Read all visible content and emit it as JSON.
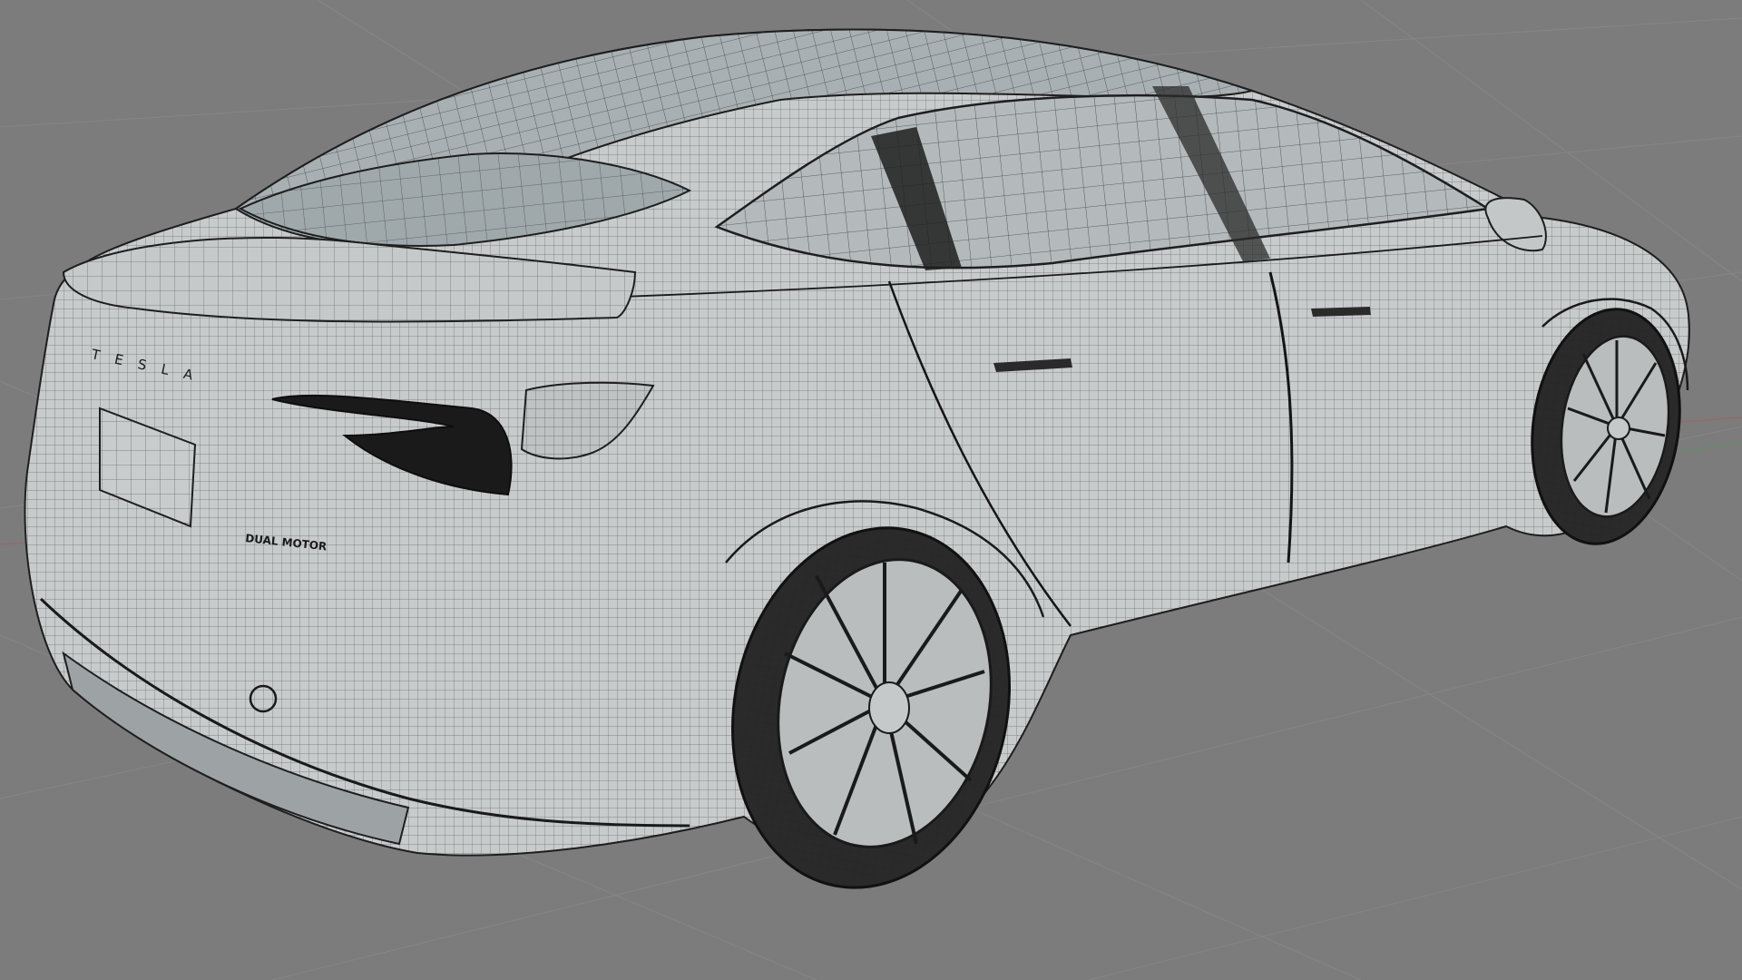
{
  "viewport": {
    "background": "#7c7c7c",
    "grid_color": "#8a8a8a",
    "x_axis_color": "#a05a5a",
    "y_axis_color": "#5a8a5a",
    "wire_color": "#1e1e1e",
    "surface_color": "#c9cccd",
    "glass_color": "#a6aeb1",
    "shadow_color": "#2a2a2a"
  },
  "model": {
    "name": "car-wireframe",
    "badges": {
      "brand_letters": "T E S L A",
      "trim_label": "DUAL MOTOR"
    }
  }
}
